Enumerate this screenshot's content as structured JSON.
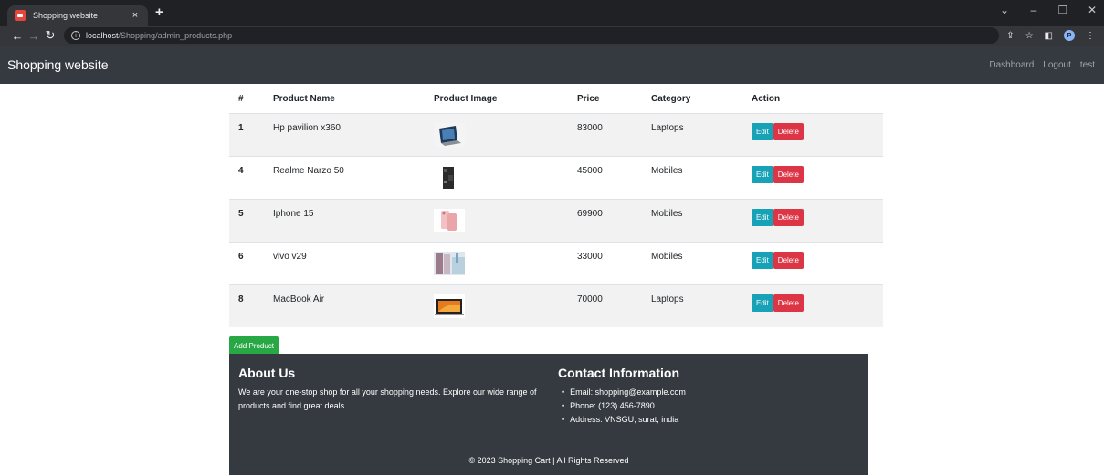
{
  "browser": {
    "tab_title": "Shopping website",
    "tab_close": "×",
    "new_tab": "+",
    "url_host": "localhost",
    "url_path": "/Shopping/admin_products.php",
    "profile_initial": "P"
  },
  "navbar": {
    "brand": "Shopping website",
    "links": [
      "Dashboard",
      "Logout",
      "test"
    ]
  },
  "table": {
    "headers": [
      "#",
      "Product Name",
      "Product Image",
      "Price",
      "Category",
      "Action"
    ],
    "rows": [
      {
        "id": "1",
        "name": "Hp pavilion x360",
        "price": "83000",
        "category": "Laptops",
        "image": "laptop"
      },
      {
        "id": "4",
        "name": "Realme Narzo 50",
        "price": "45000",
        "category": "Mobiles",
        "image": "phone-dark"
      },
      {
        "id": "5",
        "name": "Iphone 15",
        "price": "69900",
        "category": "Mobiles",
        "image": "phone-pink"
      },
      {
        "id": "6",
        "name": "vivo v29",
        "price": "33000",
        "category": "Mobiles",
        "image": "phone-blue"
      },
      {
        "id": "8",
        "name": "MacBook Air",
        "price": "70000",
        "category": "Laptops",
        "image": "macbook"
      }
    ],
    "edit_label": "Edit",
    "delete_label": "Delete"
  },
  "add_product_label": "Add Product",
  "footer": {
    "about_title": "About Us",
    "about_text": "We are your one-stop shop for all your shopping needs. Explore our wide range of products and find great deals.",
    "contact_title": "Contact Information",
    "contact_items": [
      "Email: shopping@example.com",
      "Phone: (123) 456-7890",
      "Address: VNSGU, surat, india"
    ],
    "copyright": "© 2023 Shopping Cart | All Rights Reserved"
  },
  "colors": {
    "navbar_bg": "#343a40",
    "edit_btn": "#17a2b8",
    "delete_btn": "#dc3545",
    "add_btn": "#28a745"
  }
}
